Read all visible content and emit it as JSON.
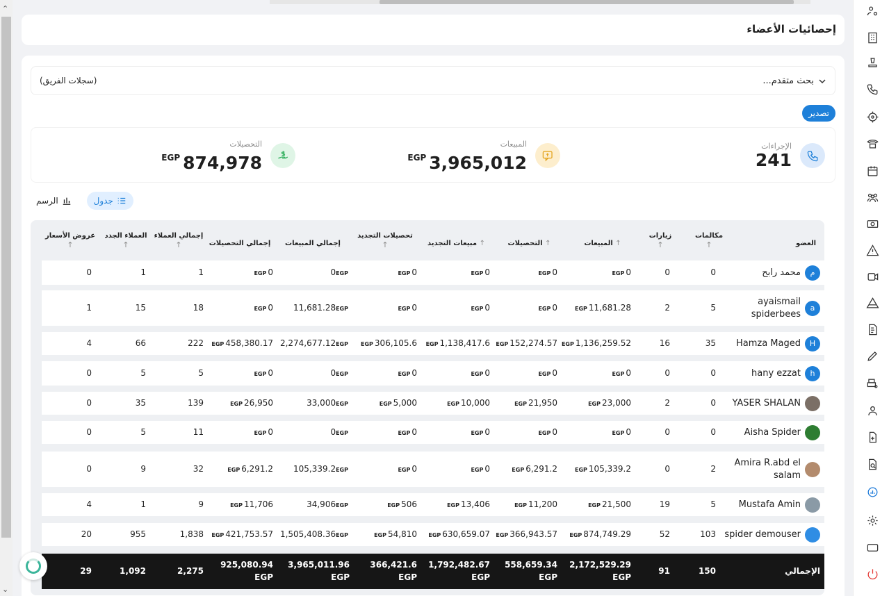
{
  "header": {
    "title": "إحصائيات الأعضاء"
  },
  "search": {
    "label": "بحث متقدم...",
    "team_label": "(سجلات الفريق)"
  },
  "export_label": "تصدير",
  "stats": [
    {
      "label": "الإجراءات",
      "value": "241",
      "currency": "",
      "icon": "phone-icon",
      "color": "#dbe9fb"
    },
    {
      "label": "المبيعات",
      "value": "3,965,012",
      "currency": "EGP",
      "icon": "sales-chat-icon",
      "color": "#fdeecd"
    },
    {
      "label": "التحصيلات",
      "value": "874,978",
      "currency": "EGP",
      "icon": "money-hand-icon",
      "color": "#dff5e6"
    }
  ],
  "view_toggle": {
    "table_label": "جدول",
    "chart_label": "الرسم"
  },
  "table": {
    "columns": {
      "member": "العضو",
      "calls": "مكالمات",
      "visits": "زيارات",
      "sales": "المبيعات",
      "collections": "التحصيلات",
      "renewal_sales": "مبيعات التجديد",
      "renewal_collections": "تحصيلات التجديد",
      "total_sales": "إجمالي المبيعات",
      "total_collections": "إجمالي التحصيلات",
      "total_clients": "إجمالي العملاء",
      "new_clients": "العملاء الجدد",
      "quotes": "عروض الأسعار"
    },
    "currency": "EGP",
    "rows": [
      {
        "name": "محمد رابح",
        "avatar": "م",
        "calls": "0",
        "visits": "0",
        "sales": "0",
        "collections": "0",
        "renewal_sales": "0",
        "renewal_collections": "0",
        "total_sales": "0",
        "total_collections": "0",
        "total_clients": "1",
        "new_clients": "1",
        "quotes": "0"
      },
      {
        "name": "ayaismail spiderbees",
        "avatar": "a",
        "calls": "5",
        "visits": "2",
        "sales": "11,681.28",
        "collections": "0",
        "renewal_sales": "0",
        "renewal_collections": "0",
        "total_sales": "11,681.28",
        "total_collections": "0",
        "total_clients": "18",
        "new_clients": "15",
        "quotes": "1"
      },
      {
        "name": "Hamza Maged",
        "avatar": "H",
        "calls": "35",
        "visits": "16",
        "sales": "1,136,259.52",
        "collections": "152,274.57",
        "renewal_sales": "1,138,417.6",
        "renewal_collections": "306,105.6",
        "total_sales": "2,274,677.12",
        "total_collections": "458,380.17",
        "total_clients": "222",
        "new_clients": "66",
        "quotes": "4"
      },
      {
        "name": "hany ezzat",
        "avatar": "h",
        "calls": "0",
        "visits": "0",
        "sales": "0",
        "collections": "0",
        "renewal_sales": "0",
        "renewal_collections": "0",
        "total_sales": "0",
        "total_collections": "0",
        "total_clients": "5",
        "new_clients": "5",
        "quotes": "0"
      },
      {
        "name": "YASER SHALAN",
        "avatar": "",
        "calls": "0",
        "visits": "2",
        "sales": "23,000",
        "collections": "21,950",
        "renewal_sales": "10,000",
        "renewal_collections": "5,000",
        "total_sales": "33,000",
        "total_collections": "26,950",
        "total_clients": "139",
        "new_clients": "35",
        "quotes": "0"
      },
      {
        "name": "Aisha Spider",
        "avatar": "",
        "calls": "0",
        "visits": "0",
        "sales": "0",
        "collections": "0",
        "renewal_sales": "0",
        "renewal_collections": "0",
        "total_sales": "0",
        "total_collections": "0",
        "total_clients": "11",
        "new_clients": "5",
        "quotes": "0"
      },
      {
        "name": "Amira R.abd el salam",
        "avatar": "",
        "calls": "2",
        "visits": "0",
        "sales": "105,339.2",
        "collections": "6,291.2",
        "renewal_sales": "0",
        "renewal_collections": "0",
        "total_sales": "105,339.2",
        "total_collections": "6,291.2",
        "total_clients": "32",
        "new_clients": "9",
        "quotes": "0"
      },
      {
        "name": "Mustafa Amin",
        "avatar": "",
        "calls": "5",
        "visits": "19",
        "sales": "21,500",
        "collections": "11,200",
        "renewal_sales": "13,406",
        "renewal_collections": "506",
        "total_sales": "34,906",
        "total_collections": "11,706",
        "total_clients": "9",
        "new_clients": "1",
        "quotes": "4"
      },
      {
        "name": "spider demouser",
        "avatar": "",
        "calls": "103",
        "visits": "52",
        "sales": "874,749.29",
        "collections": "366,943.57",
        "renewal_sales": "630,659.07",
        "renewal_collections": "54,810",
        "total_sales": "1,505,408.36",
        "total_collections": "421,753.57",
        "total_clients": "1,838",
        "new_clients": "955",
        "quotes": "20"
      }
    ],
    "total": {
      "label": "الإجمالي",
      "calls": "150",
      "visits": "91",
      "sales": "2,172,529.29",
      "collections": "558,659.34",
      "renewal_sales": "1,792,482.67",
      "renewal_collections": "366,421.6",
      "total_sales": "3,965,011.96",
      "total_collections": "925,080.94",
      "total_clients": "2,275",
      "new_clients": "1,092",
      "quotes": "29"
    }
  },
  "sidebar_icons": [
    "users-gear-icon",
    "building-icon",
    "stamp-icon",
    "phone-call-icon",
    "target-icon",
    "telephone-icon",
    "calendar-icon",
    "team-icon",
    "cash-icon",
    "warning-icon",
    "video-icon",
    "pyramid-icon",
    "invoice-icon",
    "pen-icon",
    "printer-user-icon",
    "user-support-icon",
    "add-document-icon",
    "document-search-icon",
    "analytics-icon",
    "settings-icon",
    "window-icon",
    "power-icon"
  ]
}
